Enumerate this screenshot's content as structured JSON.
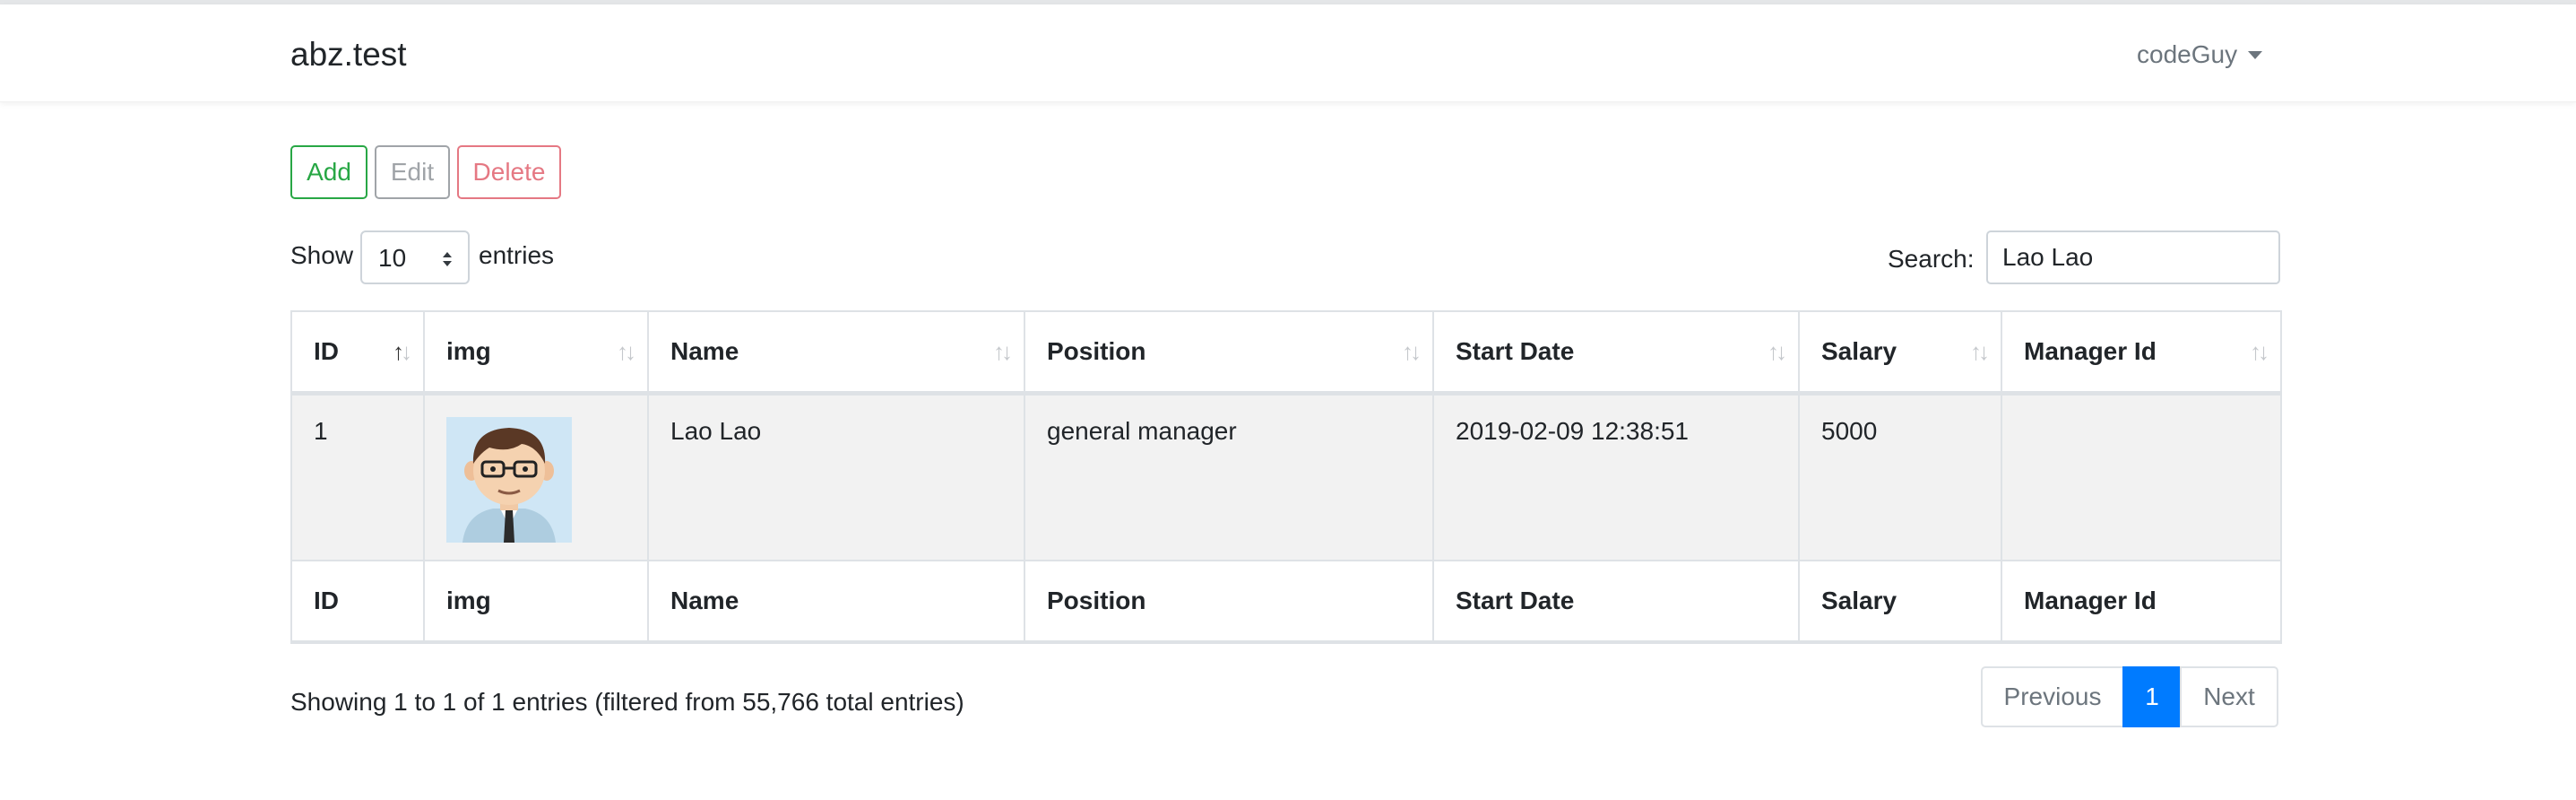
{
  "navbar": {
    "brand": "abz.test",
    "user": "codeGuy"
  },
  "toolbar": {
    "add_label": "Add",
    "edit_label": "Edit",
    "delete_label": "Delete"
  },
  "length": {
    "prefix": "Show",
    "value": "10",
    "suffix": "entries"
  },
  "search": {
    "label": "Search:",
    "value": "Lao Lao"
  },
  "table": {
    "columns": [
      "ID",
      "img",
      "Name",
      "Position",
      "Start Date",
      "Salary",
      "Manager Id"
    ],
    "rows": [
      {
        "id": "1",
        "img": "avatar",
        "name": "Lao Lao",
        "position": "general manager",
        "start_date": "2019-02-09 12:38:51",
        "salary": "5000",
        "manager_id": ""
      }
    ]
  },
  "info": "Showing 1 to 1 of 1 entries (filtered from 55,766 total entries)",
  "pagination": {
    "previous": "Previous",
    "current": "1",
    "next": "Next"
  },
  "colors": {
    "add": "#28a745",
    "edit": "#a0a4a8",
    "delete": "#e57883",
    "active_page": "#007bff",
    "row_bg": "#f2f2f2"
  }
}
